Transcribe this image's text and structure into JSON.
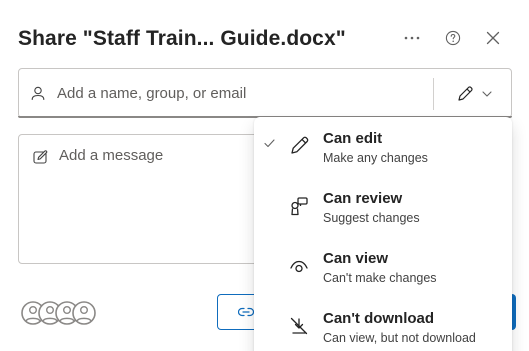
{
  "dialog": {
    "title": "Share \"Staff Train... Guide.docx\"",
    "more_icon": "more-horizontal-icon",
    "help_icon": "question-circle-icon",
    "close_icon": "close-icon"
  },
  "people": {
    "placeholder": "Add a name, group, or email",
    "person_icon": "person-icon",
    "permission_icon": "pencil-icon",
    "chevron_icon": "chevron-down-icon"
  },
  "message": {
    "placeholder": "Add a message",
    "icon": "compose-icon"
  },
  "footer": {
    "avatars_icon": "people-group-icon",
    "copy_link_icon": "link-icon"
  },
  "permission_menu": {
    "selected": "Can edit",
    "items": [
      {
        "title": "Can edit",
        "subtitle": "Make any changes",
        "icon": "pencil-icon",
        "checked": true
      },
      {
        "title": "Can review",
        "subtitle": "Suggest changes",
        "icon": "review-icon",
        "checked": false
      },
      {
        "title": "Can view",
        "subtitle": "Can't make changes",
        "icon": "eye-icon",
        "checked": false
      },
      {
        "title": "Can't download",
        "subtitle": "Can view, but not download",
        "icon": "no-download-icon",
        "checked": false
      }
    ]
  },
  "colors": {
    "accent": "#0f6cbd",
    "text": "#242424",
    "muted": "#605e5c",
    "border": "#c8c6c4"
  }
}
